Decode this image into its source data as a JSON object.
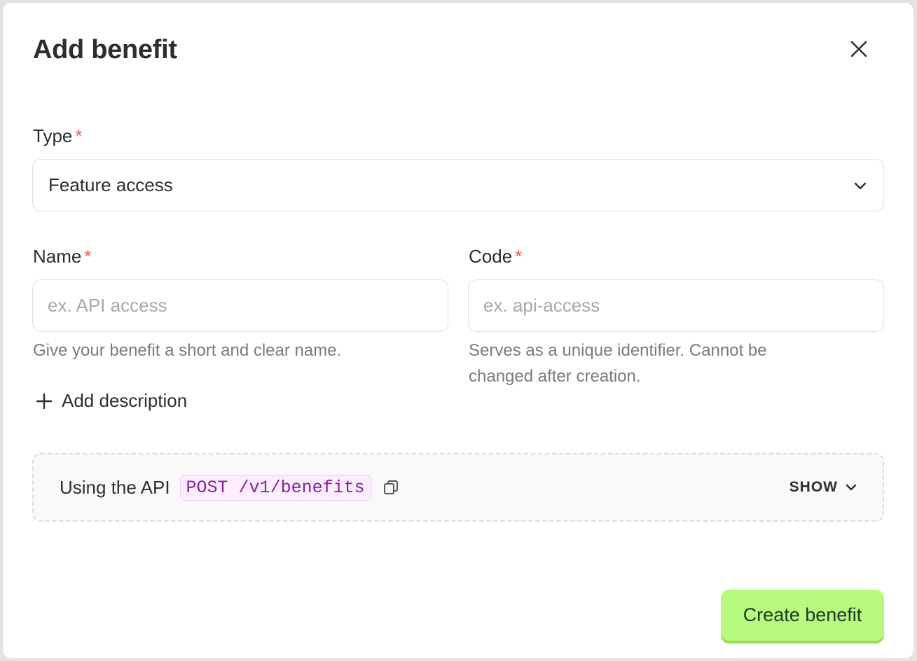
{
  "modal": {
    "title": "Add benefit",
    "close_icon": "close-icon"
  },
  "type_field": {
    "label": "Type",
    "required_mark": "*",
    "selected_value": "Feature access",
    "dropdown_icon": "chevron-down-icon"
  },
  "name_field": {
    "label": "Name",
    "required_mark": "*",
    "value": "",
    "placeholder": "ex. API access",
    "help": "Give your benefit a short and clear name."
  },
  "code_field": {
    "label": "Code",
    "required_mark": "*",
    "value": "",
    "placeholder": "ex. api-access",
    "help": "Serves as a unique identifier. Cannot be changed after creation."
  },
  "add_description": {
    "label": "Add description",
    "icon": "plus-icon"
  },
  "api_panel": {
    "label": "Using the API",
    "endpoint": "POST /v1/benefits",
    "copy_icon": "copy-icon",
    "toggle_label": "SHOW",
    "toggle_icon": "chevron-down-icon"
  },
  "actions": {
    "submit_label": "Create benefit"
  },
  "colors": {
    "required": "#ee5a5a",
    "primary_button": "#b8fa7e",
    "endpoint_text": "#8a1ca6",
    "endpoint_background": "#fdeefd"
  }
}
